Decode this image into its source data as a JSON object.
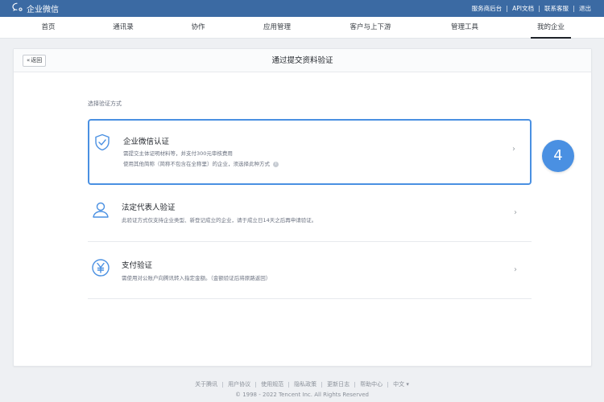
{
  "topbar": {
    "brand": "企业微信",
    "links": [
      "服务商后台",
      "API文档",
      "联系客服",
      "退出"
    ]
  },
  "nav": {
    "tabs": [
      "首页",
      "通讯录",
      "协作",
      "应用管理",
      "客户与上下游",
      "管理工具",
      "我的企业"
    ],
    "active": "我的企业"
  },
  "card": {
    "back_label": "返回",
    "title": "通过提交资料验证",
    "section_label": "选择验证方式"
  },
  "options": [
    {
      "title": "企业微信认证",
      "desc1": "需提交主体证明材料等，并支付300元审核费用",
      "desc2": "使用其他简称（简称不包含在全称里）的企业，须选择此种方式",
      "icon": "shield-check-icon",
      "selected": true
    },
    {
      "title": "法定代表人验证",
      "desc1": "此验证方式仅支持企业类型、新登记成立的企业，请于成立日14天之后再申请验证。",
      "icon": "person-icon",
      "selected": false
    },
    {
      "title": "支付验证",
      "desc1": "需使用对公账户向腾讯转入指定金额。（金额验证后将原路返回）",
      "icon": "yen-icon",
      "selected": false
    }
  ],
  "step_badge": "4",
  "footer": {
    "links": [
      "关于腾讯",
      "用户协议",
      "使用规范",
      "隐私政策",
      "更新日志",
      "帮助中心",
      "中文 ▾"
    ],
    "copyright": "© 1998 - 2022 Tencent Inc. All Rights Reserved"
  },
  "colors": {
    "topbar": "#3b6aa3",
    "accent": "#4a90e2",
    "icon": "#4a90e2"
  }
}
